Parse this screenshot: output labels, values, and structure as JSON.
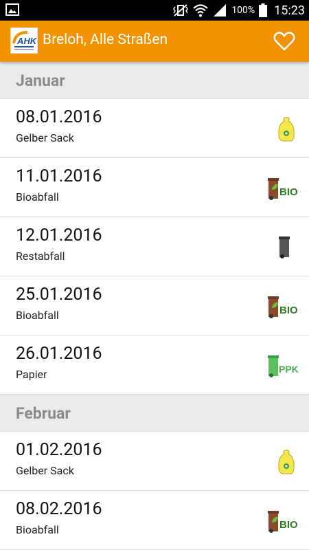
{
  "status": {
    "battery": "100%",
    "time": "15:23"
  },
  "header": {
    "logo_text": "AHK",
    "title": "Breloh, Alle Straßen"
  },
  "sections": [
    {
      "month": "Januar",
      "items": [
        {
          "date": "08.01.2016",
          "type": "Gelber Sack"
        },
        {
          "date": "11.01.2016",
          "type": "Bioabfall",
          "icon_label": "BIO"
        },
        {
          "date": "12.01.2016",
          "type": "Restabfall"
        },
        {
          "date": "25.01.2016",
          "type": "Bioabfall",
          "icon_label": "BIO"
        },
        {
          "date": "26.01.2016",
          "type": "Papier",
          "icon_label": "PPK"
        }
      ]
    },
    {
      "month": "Februar",
      "items": [
        {
          "date": "01.02.2016",
          "type": "Gelber Sack"
        },
        {
          "date": "08.02.2016",
          "type": "Bioabfall",
          "icon_label": "BIO"
        }
      ]
    }
  ],
  "colors": {
    "appbar": "#f39200",
    "bio": "#8b4a2b",
    "bio_text": "#2e7d1f",
    "papier": "#4caf50",
    "rest": "#555555",
    "gelber_sack": "#f2e84b"
  }
}
